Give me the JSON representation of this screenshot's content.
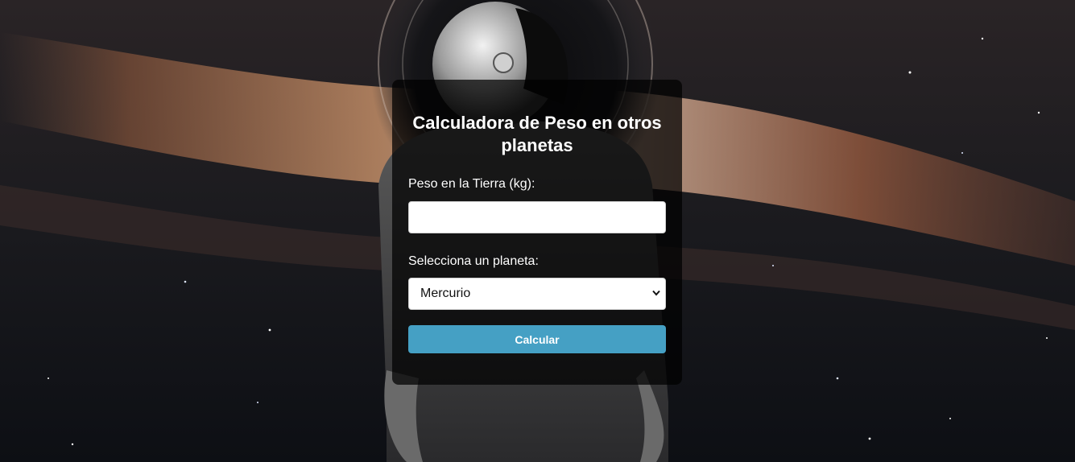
{
  "form": {
    "title": "Calculadora de Peso en otros planetas",
    "weight_label": "Peso en la Tierra (kg):",
    "weight_value": "",
    "planet_label": "Selecciona un planeta:",
    "planet_selected": "Mercurio",
    "calculate_label": "Calcular"
  },
  "icons": {
    "select_arrow": "chevron-down-icon"
  },
  "colors": {
    "button": "#45a0c4",
    "card_background": "rgba(0,0,0,0.72)",
    "text": "#ffffff"
  }
}
